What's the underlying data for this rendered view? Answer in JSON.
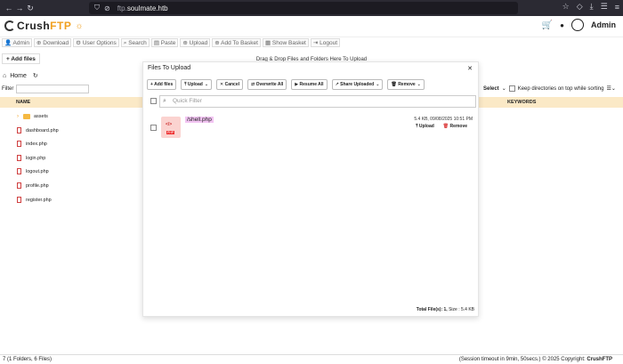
{
  "browser": {
    "url_domain": "ftp.",
    "url_rest": "soulmate.htb"
  },
  "header": {
    "logo_part1": "Crush",
    "logo_part2": "FTP",
    "user": "Admin"
  },
  "toolbar": {
    "items": [
      "Admin",
      "Download",
      "User Options",
      "Search",
      "Paste",
      "Upload",
      "Add To Basket",
      "Show Basket",
      "Logout"
    ]
  },
  "main": {
    "add_files": "+ Add files",
    "drag_drop": "Drag & Drop Files and Folders Here To Upload",
    "breadcrumb_home": "Home",
    "filter_label": "Filter",
    "select_label": "Select",
    "keep_dirs_label": "Keep directories on top while sorting",
    "col_name": "NAME",
    "col_keywords": "KEYWORDS",
    "rows": [
      {
        "name": "assets",
        "type": "folder"
      },
      {
        "name": "dashboard.php",
        "type": "file"
      },
      {
        "name": "index.php",
        "type": "file"
      },
      {
        "name": "login.php",
        "type": "file"
      },
      {
        "name": "logout.php",
        "type": "file"
      },
      {
        "name": "profile.php",
        "type": "file"
      },
      {
        "name": "register.php",
        "type": "file"
      }
    ]
  },
  "footer": {
    "left": "7 (1 Folders, 6 Files)",
    "right": "(Session timeout in 9min, 50secs.) © 2025 Copyright: ",
    "brand": "CrushFTP"
  },
  "modal": {
    "title": "Files To Upload",
    "buttons": [
      "Add files",
      "Upload",
      "Cancel",
      "Overwrite All",
      "Resume All",
      "Share Uploaded",
      "Remove"
    ],
    "quick_filter": "Quick Filter",
    "file": {
      "name": "/shell.php",
      "meta": "5.4 KB, 09/08/2025 10:51 PM",
      "upload": "Upload",
      "remove": "Remove",
      "icon_tag": "PHP"
    },
    "total_label": "Total File(s): 1,",
    "total_size": "Size : 5.4 KB"
  }
}
